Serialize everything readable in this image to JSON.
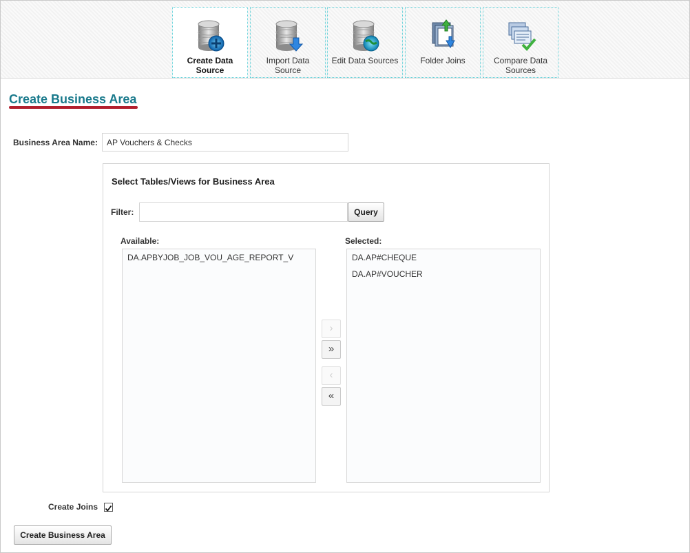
{
  "toolbar": {
    "items": [
      {
        "label": "Create Data Source",
        "icon": "database-plus-icon",
        "active": true
      },
      {
        "label": "Import Data Source",
        "icon": "database-import-icon",
        "active": false
      },
      {
        "label": "Edit Data Sources",
        "icon": "database-globe-icon",
        "active": false
      },
      {
        "label": "Folder Joins",
        "icon": "folder-join-icon",
        "active": false
      },
      {
        "label": "Compare Data Sources",
        "icon": "compare-documents-icon",
        "active": false
      }
    ]
  },
  "page": {
    "title": "Create Business Area"
  },
  "form": {
    "business_area_name_label": "Business Area Name:",
    "business_area_name_value": "AP Vouchers & Checks"
  },
  "panel": {
    "title": "Select Tables/Views for Business Area",
    "filter_label": "Filter:",
    "filter_value": "",
    "query_button": "Query",
    "available_label": "Available:",
    "selected_label": "Selected:",
    "available_items": [
      "DA.APBYJOB_JOB_VOU_AGE_REPORT_V"
    ],
    "selected_items": [
      "DA.AP#CHEQUE",
      "DA.AP#VOUCHER"
    ],
    "shuttle": {
      "move_right": "›",
      "move_all_right": "»",
      "move_left": "‹",
      "move_all_left": "«"
    }
  },
  "options": {
    "create_joins_label": "Create Joins",
    "create_joins_checked": true
  },
  "actions": {
    "create_button": "Create Business Area"
  },
  "colors": {
    "title": "#1a7a8c",
    "title_underline": "#b21f2d",
    "toolbar_border": "#5fd0d8"
  }
}
